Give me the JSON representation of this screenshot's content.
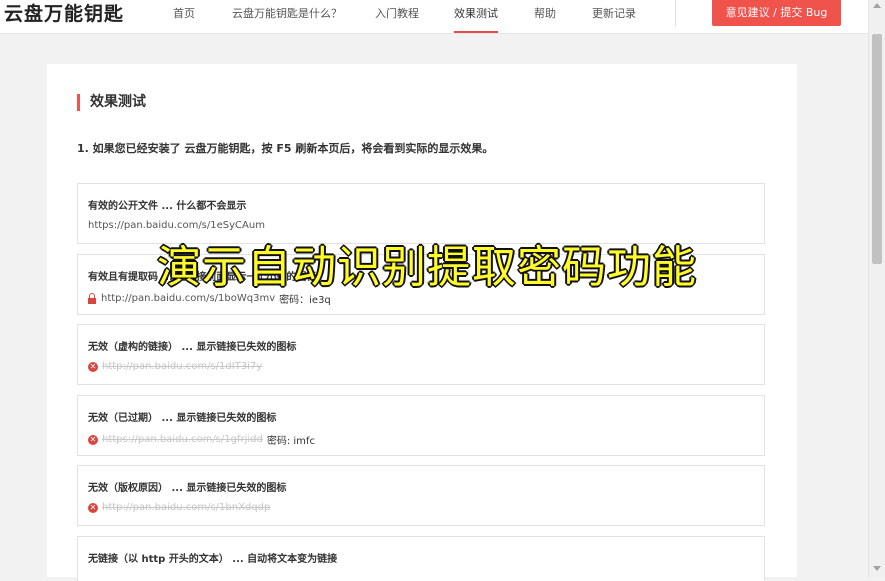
{
  "header": {
    "logo": "云盘万能钥匙",
    "nav": [
      {
        "label": "首页",
        "active": false
      },
      {
        "label": "云盘万能钥匙是什么？",
        "active": false
      },
      {
        "label": "入门教程",
        "active": false
      },
      {
        "label": "效果测试",
        "active": true
      },
      {
        "label": "帮助",
        "active": false
      },
      {
        "label": "更新记录",
        "active": false
      }
    ],
    "bug_button": "意见建议 / 提交 Bug"
  },
  "main": {
    "section_title": "效果测试",
    "intro": "1. 如果您已经安装了 云盘万能钥匙，按 F5 刷新本页后，将会看到实际的显示效果。",
    "cards": [
      {
        "title": "有效的公开文件 ... 什么都不会显示",
        "link": "https://pan.baidu.com/s/1eSyCAum",
        "icon": "none",
        "dead": false
      },
      {
        "title": "有效且有提取码 ... 在链接前面显示一个小锁的图标",
        "link": "http://pan.baidu.com/s/1boWq3mv",
        "password": "密码：ie3q",
        "icon": "lock-icon",
        "dead": false
      },
      {
        "title": "无效（虚构的链接） ... 显示链接已失效的图标",
        "link": "http://pan.baidu.com/s/1dIT3i7y",
        "icon": "error-icon",
        "dead": true
      },
      {
        "title": "无效（已过期） ... 显示链接已失效的图标",
        "link": "https://pan.baidu.com/s/1gfrjidd",
        "password": "密码: imfc",
        "icon": "error-icon",
        "dead": true
      },
      {
        "title": "无效（版权原因） ... 显示链接已失效的图标",
        "link": "http://pan.baidu.com/s/1bnXdqdp",
        "icon": "error-icon",
        "dead": true
      },
      {
        "title": "无链接（以 http 开头的文本） ... 自动将文本变为链接"
      }
    ]
  },
  "overlay_caption": "演示自动识别提取密码功能",
  "colors": {
    "accent": "#f0524c",
    "error": "#d9463f",
    "caption": "#fffc2a"
  }
}
